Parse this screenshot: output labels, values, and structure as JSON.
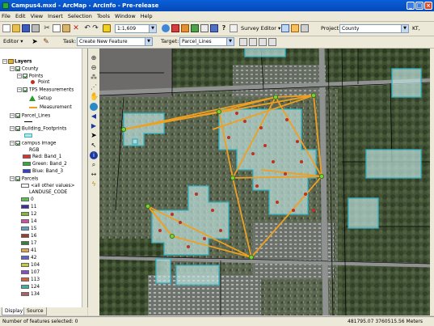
{
  "window": {
    "title": "Campus4.mxd - ArcMap - ArcInfo - Pre-release",
    "min": "_",
    "max": "□",
    "close": "×"
  },
  "menu": [
    "File",
    "Edit",
    "View",
    "Insert",
    "Selection",
    "Tools",
    "Window",
    "Help"
  ],
  "toolbar": {
    "scale": "1:1,609",
    "survey_editor": "Survey Editor ▾",
    "project_label": "Project:",
    "project_value": "County",
    "extra": "KT,",
    "editor": "Editor ▾",
    "task_label": "Task:",
    "task_value": "Create New Feature",
    "target_label": "Target:",
    "target_value": "Parcel_Lines"
  },
  "toc": {
    "layers_title": "Layers",
    "county": "County",
    "points": "Points",
    "point": "Point",
    "tps": "TPS Measurements",
    "setup": "Setup",
    "measurement": "Measurement",
    "parcel_lines": "Parcel_Lines",
    "building_footprints": "Building_Footprints",
    "campus_image": "campus image",
    "rgb": "RGB",
    "red": "Red:   Band_1",
    "green": "Green: Band_2",
    "blue": "Blue:   Band_3",
    "parcels": "Parcels",
    "all_other": "<all other values>",
    "landuse": "LANDUSE_CODE",
    "codes": [
      "0",
      "11",
      "12",
      "14",
      "15",
      "16",
      "17",
      "41",
      "42",
      "104",
      "107",
      "113",
      "124",
      "134"
    ],
    "colors": [
      "#55c455",
      "#3b2da8",
      "#7fb93a",
      "#d04fa4",
      "#5aa0c8",
      "#a23a2a",
      "#3a7d3a",
      "#e8a04a",
      "#6060d0",
      "#c8c840",
      "#8a4ad0",
      "#d86040",
      "#40b0a0",
      "#b06060"
    ]
  },
  "tabs": {
    "display": "Display",
    "source": "Source"
  },
  "status": {
    "selected": "Number of features selected: 0",
    "coords": "481795.07  3760515.56 Meters"
  },
  "colors": {
    "title_bar": "#0549b8",
    "chrome": "#ece9d8",
    "building": "#bfe3de",
    "building_edge": "#2fb4c4",
    "survey_line": "#f0a020",
    "survey_point": "#c03020"
  },
  "icons": [
    "new-icon",
    "open-icon",
    "save-icon",
    "print-icon",
    "cut-icon",
    "copy-icon",
    "paste-icon",
    "delete-icon",
    "undo-icon",
    "redo-icon",
    "add-data-icon",
    "zoom-in-icon",
    "zoom-out-icon",
    "pan-icon",
    "full-extent-icon",
    "identify-icon",
    "find-icon",
    "measure-icon",
    "arrow-icon",
    "edit-tool-icon",
    "sketch-icon"
  ]
}
